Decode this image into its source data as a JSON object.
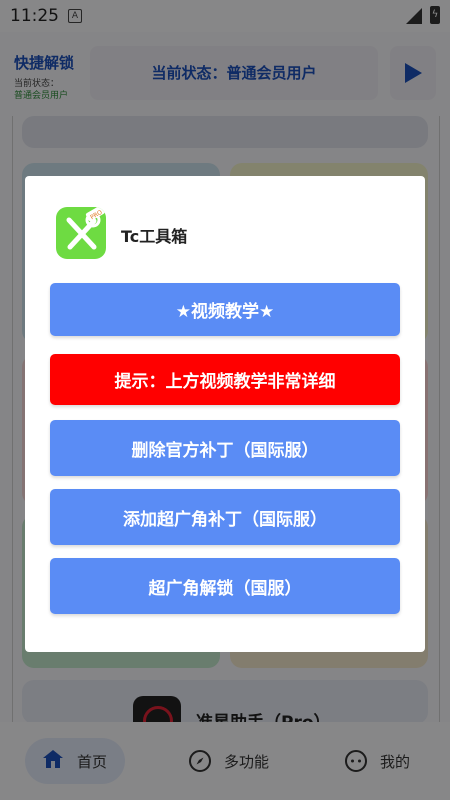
{
  "status_bar": {
    "time": "11:25",
    "notification_icon": "A"
  },
  "header": {
    "app_title": "快捷解锁",
    "status_label": "当前状态：",
    "status_value": "普通会员用户",
    "status_banner": "当前状态：普通会员用户"
  },
  "background_cards": {
    "helper_app_label": "准星助手（Pro）"
  },
  "dialog": {
    "app_name": "Tc工具箱",
    "buttons": [
      {
        "label": "★视频教学★",
        "color": "#5a8cf5"
      },
      {
        "label": "提示：上方视频教学非常详细",
        "color": "#ff0000"
      },
      {
        "label": "删除官方补丁（国际服）",
        "color": "#5a8cf5"
      },
      {
        "label": "添加超广角补丁（国际服）",
        "color": "#5a8cf5"
      },
      {
        "label": "超广角解锁（国服）",
        "color": "#5a8cf5"
      }
    ]
  },
  "bottom_nav": {
    "items": [
      {
        "label": "首页",
        "icon": "home-icon",
        "active": true
      },
      {
        "label": "多功能",
        "icon": "compass-icon",
        "active": false
      },
      {
        "label": "我的",
        "icon": "profile-face-icon",
        "active": false
      }
    ]
  },
  "colors": {
    "accent": "#1c4fb8",
    "button_blue": "#5a8cf5",
    "warning_red": "#ff0000",
    "status_green": "#2e8b3a"
  }
}
